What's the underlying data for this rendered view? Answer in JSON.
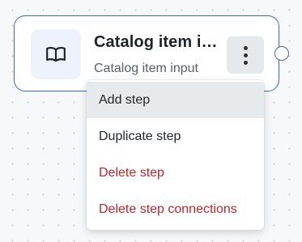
{
  "node": {
    "icon": "book-open-icon",
    "title": "Catalog item input",
    "subtitle": "Catalog item input",
    "menu_icon": "more-vertical-icon",
    "border_color": "#3f63d8",
    "icon_bg_color": "#edf2fd"
  },
  "context_menu": {
    "items": [
      {
        "label": "Add step",
        "variant": "default",
        "state": "hovered"
      },
      {
        "label": "Duplicate step",
        "variant": "default",
        "state": "normal"
      },
      {
        "label": "Delete step",
        "variant": "danger",
        "state": "normal"
      },
      {
        "label": "Delete step connections",
        "variant": "danger",
        "state": "normal"
      }
    ],
    "danger_color": "#c0262d",
    "hover_bg_color": "#e7eaed"
  }
}
